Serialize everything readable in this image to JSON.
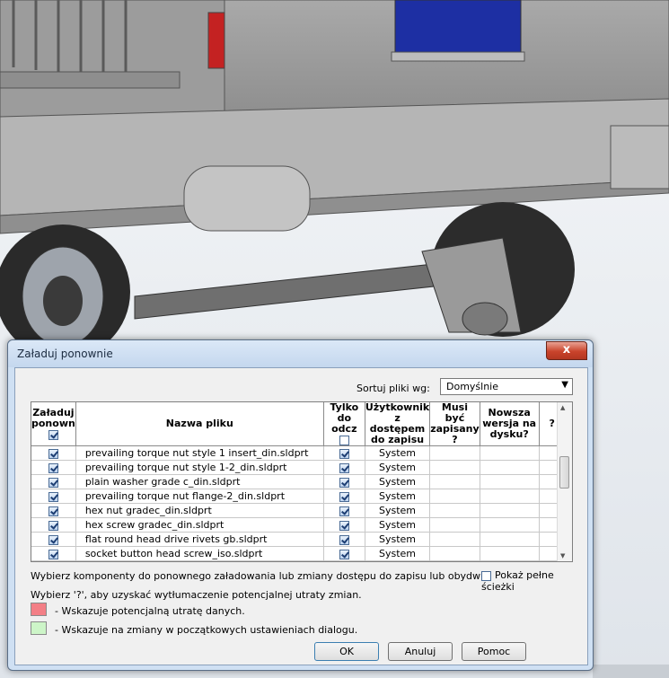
{
  "dialog": {
    "title": "Załaduj ponownie",
    "close_label": "x",
    "sort_label": "Sortuj pliki wg:",
    "sort_value": "Domyślnie",
    "columns": [
      "Załaduj ponown",
      "Nazwa pliku",
      "Tylko do odcz",
      "Użytkownik z dostępem do zapisu",
      "Musi być zapisany ?",
      "Nowsza wersja na dysku?",
      "?"
    ],
    "rows": [
      {
        "name": "prevailing torque nut style 1 insert_din.sldprt",
        "user": "System"
      },
      {
        "name": "prevailing torque nut style 1-2_din.sldprt",
        "user": "System"
      },
      {
        "name": "plain washer grade c_din.sldprt",
        "user": "System"
      },
      {
        "name": "prevailing torque nut flange-2_din.sldprt",
        "user": "System"
      },
      {
        "name": "hex nut gradec_din.sldprt",
        "user": "System"
      },
      {
        "name": "hex screw gradec_din.sldprt",
        "user": "System"
      },
      {
        "name": "flat round head drive rivets gb.sldprt",
        "user": "System"
      },
      {
        "name": "socket button head screw_iso.sldprt",
        "user": "System"
      }
    ],
    "info_text": "Wybierz komponenty do ponownego załadowania lub zmiany dostępu do zapisu lub obydwu.",
    "full_paths_label": "Pokaż pełne ścieżki",
    "hint_text": "Wybierz '?', aby uzyskać wytłumaczenie potencjalnej utraty zmian.",
    "legend_red": "- Wskazuje potencjalną utratę danych.",
    "legend_green": "- Wskazuje na zmiany w początkowych ustawieniach dialogu.",
    "ok_label": "OK",
    "cancel_label": "Anuluj",
    "help_label": "Pomoc"
  },
  "colors": {
    "legend_red": "#f37f86",
    "legend_green": "#cdf5c8",
    "window_frame": "#cfe0f3",
    "close_button": "#c9432b"
  }
}
